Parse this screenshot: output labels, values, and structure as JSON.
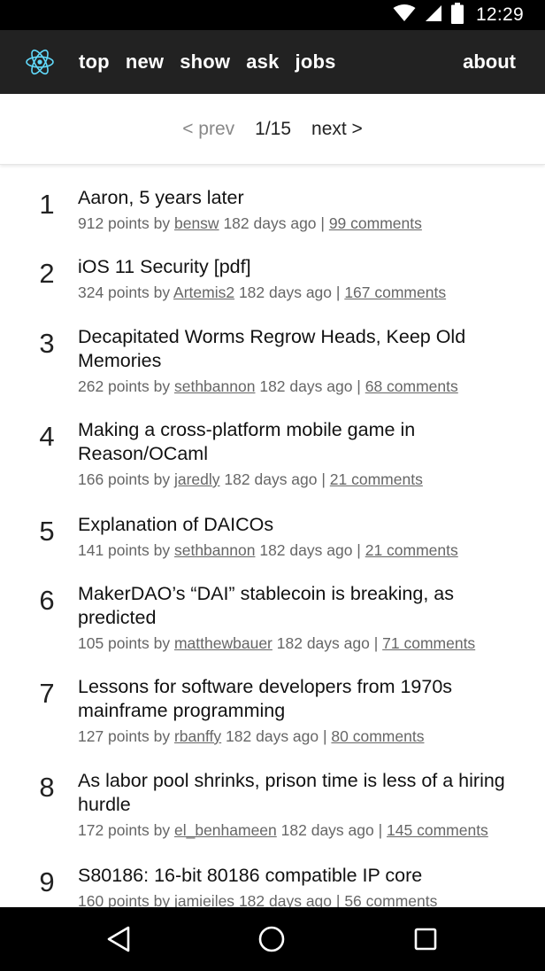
{
  "status_bar": {
    "time": "12:29",
    "icons": [
      "wifi-icon",
      "cell-signal-icon",
      "battery-icon"
    ]
  },
  "header": {
    "logo_icon": "react-atom-icon",
    "accent": "#61dafb",
    "background": "#222222",
    "nav": [
      {
        "label": "top"
      },
      {
        "label": "new"
      },
      {
        "label": "show"
      },
      {
        "label": "ask"
      },
      {
        "label": "jobs"
      }
    ],
    "about": "about"
  },
  "pager": {
    "prev": "< prev",
    "count": "1/15",
    "next": "next >"
  },
  "stories": [
    {
      "rank": "1",
      "title": "Aaron, 5 years later",
      "points": "912 points by",
      "user": "bensw",
      "time": "182 days ago |",
      "comments": "99 comments"
    },
    {
      "rank": "2",
      "title": "iOS 11 Security [pdf]",
      "points": "324 points by",
      "user": "Artemis2",
      "time": "182 days ago |",
      "comments": "167 comments"
    },
    {
      "rank": "3",
      "title": "Decapitated Worms Regrow Heads, Keep Old Memories",
      "points": "262 points by",
      "user": "sethbannon",
      "time": "182 days ago |",
      "comments": "68 comments"
    },
    {
      "rank": "4",
      "title": "Making a cross-platform mobile game in Reason/OCaml",
      "points": "166 points by",
      "user": "jaredly",
      "time": "182 days ago |",
      "comments": "21 comments"
    },
    {
      "rank": "5",
      "title": "Explanation of DAICOs",
      "points": "141 points by",
      "user": "sethbannon",
      "time": "182 days ago |",
      "comments": "21 comments"
    },
    {
      "rank": "6",
      "title": "MakerDAO’s “DAI” stablecoin is breaking, as predicted",
      "points": "105 points by",
      "user": "matthewbauer",
      "time": "182 days ago |",
      "comments": "71 comments"
    },
    {
      "rank": "7",
      "title": "Lessons for software developers from 1970s mainframe programming",
      "points": "127 points by",
      "user": "rbanffy",
      "time": "182 days ago |",
      "comments": "80 comments"
    },
    {
      "rank": "8",
      "title": "As labor pool shrinks, prison time is less of a hiring hurdle",
      "points": "172 points by",
      "user": "el_benhameen",
      "time": "182 days ago |",
      "comments": "145 comments"
    },
    {
      "rank": "9",
      "title": "S80186: 16-bit 80186 compatible IP core",
      "points": "160 points by",
      "user": "jamieiles",
      "time": "182 days ago |",
      "comments": "56 comments"
    }
  ],
  "nav_bar": {
    "icons": [
      "back-icon",
      "home-icon",
      "recents-icon"
    ]
  }
}
